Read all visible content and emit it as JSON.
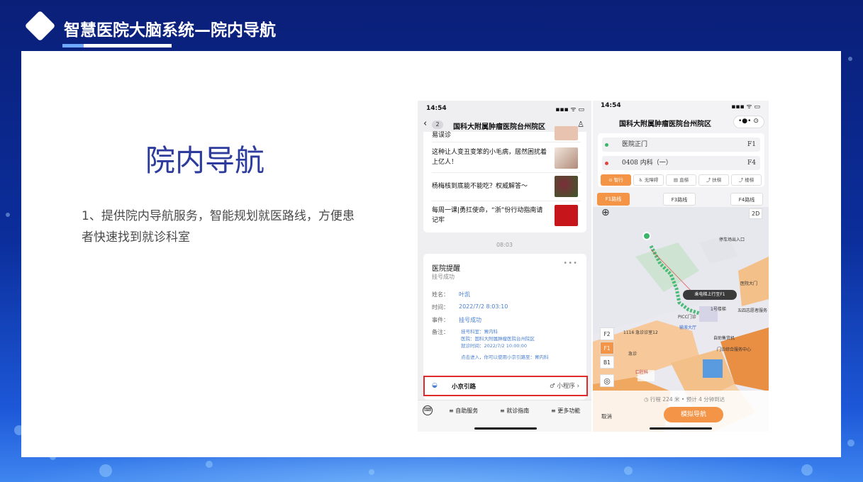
{
  "slide": {
    "title": "智慧医院大脑系统—院内导航",
    "heading": "院内导航",
    "description": "1、提供院内导航服务，智能规划就医路线，方便患者快速找到就诊科室"
  },
  "phone1": {
    "time": "14:54",
    "status_right": "▪▪▪ ᯤ ▭",
    "back_glyph": "‹",
    "badge": "2",
    "nav_title": "国科大附属肿瘤医院台州院区",
    "user_glyph": "♙",
    "news": [
      {
        "title": "易误诊"
      },
      {
        "title": "这种让人变丑变笨的小毛病，居然困扰着上亿人！"
      },
      {
        "title": "杨梅核到底能不能吃？权威解答～"
      },
      {
        "title": "每周一课|勇扛使命，“浙”份行动指南请记牢"
      }
    ],
    "timestamp": "08:03",
    "reminder": {
      "title": "医院提醒",
      "subtitle": "挂号成功",
      "menu": "•••",
      "name_key": "姓名：",
      "name_val": "叶凯",
      "time_key": "时间：",
      "time_val": "2022/7/2 8:03:10",
      "event_key": "事件：",
      "event_val": "挂号成功",
      "note_key": "备注：",
      "note_lines": [
        "挂号科室：胃内科",
        "医院：国科大附属肿瘤医院台州院区",
        "就诊时间：2022/7/2 10:00:00",
        "",
        "点击进入，你可以使用小京引路至：胃内科"
      ]
    },
    "mini_program": {
      "icon": "◒",
      "label": "小京引路",
      "right": "♂ 小程序 ›"
    },
    "bottom_tabs": {
      "keyboard": "⌨",
      "tab1": "≡ 自助服务",
      "tab2": "≡ 就诊指南",
      "tab3": "≡ 更多功能"
    }
  },
  "phone2": {
    "time": "14:54",
    "status_right": "▪▪▪ ᯤ ▭",
    "title": "国科大附属肿瘤医院台州院区",
    "capsule": "•●•  ⊙",
    "route": {
      "start": "医院正门",
      "start_floor": "F1",
      "end": "0408 内科（一）",
      "end_floor": "F4"
    },
    "modes": [
      "⊙ 智行",
      "♿ 无障碍",
      "▤ 直梯",
      "⤴ 扶梯",
      "⤴ 楼梯"
    ],
    "floor_routes": [
      "F1路线",
      "F3路线",
      "F4路线"
    ],
    "map_toggle": "2D",
    "map_labels": {
      "compass": "⊕",
      "parking": "停车场出入口",
      "callout": "乘电梯上行至F1",
      "stairs": "1号楼梯",
      "hall": "输液大厅",
      "picc": "PICC门诊",
      "self_machine": "自助售货机",
      "dental": "口腔科",
      "room": "1116 急诊诊室12",
      "outpatient": "门诊综合服务中心",
      "emergency": "急诊",
      "zone": "五四志愿者服务",
      "gate": "医院大门"
    },
    "floor_buttons": [
      "F2",
      "F1",
      "B1"
    ],
    "locate": "◎",
    "info": "◷ 行程 224 米 • 预计 4 分钟到达",
    "cancel": "取消",
    "simulate": "模拟导航"
  }
}
